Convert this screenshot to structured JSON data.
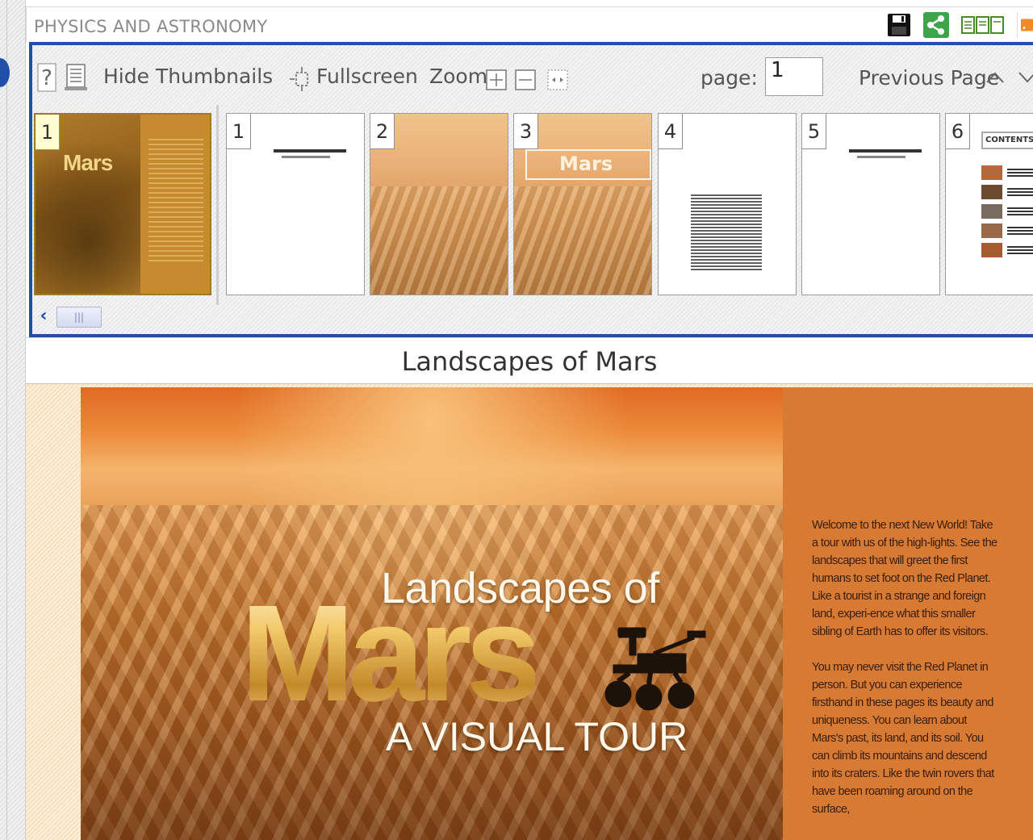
{
  "header": {
    "section_title": "PHYSICS AND ASTRONOMY",
    "icons": [
      "save-icon",
      "share-icon",
      "view-mode-icon",
      "rss-icon"
    ]
  },
  "toolbar": {
    "hide_thumbnails": "Hide Thumbnails",
    "fullscreen": "Fullscreen",
    "zoom_label": "Zoom:",
    "page_label": "page:",
    "page_value": "1",
    "previous_page": "Previous Page"
  },
  "thumbnails": [
    {
      "number": "1",
      "kind": "cover",
      "title": "Mars",
      "active": true
    },
    {
      "number": "1",
      "kind": "title-page",
      "title": "Landscapes of Mars"
    },
    {
      "number": "2",
      "kind": "photo"
    },
    {
      "number": "3",
      "kind": "photo-title",
      "title": "Mars"
    },
    {
      "number": "4",
      "kind": "text"
    },
    {
      "number": "5",
      "kind": "title-page",
      "title": "Landscapes of Mars"
    },
    {
      "number": "6",
      "kind": "contents",
      "title": "CONTENTS"
    }
  ],
  "document": {
    "title": "Landscapes of Mars",
    "cover": {
      "line1": "Landscapes of",
      "line2": "Mars",
      "line3": "A VISUAL TOUR"
    },
    "blurb": [
      "Welcome to the next New World! Take a tour with us of the high-lights. See the landscapes that will greet the first humans to set foot on the Red Planet. Like a tourist in a strange and foreign land, experi-ence what this smaller sibling of Earth has to offer its visitors.",
      "You may never visit the Red Planet in person. But you can experience firsthand in these pages its beauty and uniqueness. You can learn about Mars's past, its land, and its soil. You can climb its mountains and descend into its craters. Like the twin rovers that have been roaming around on the surface,"
    ]
  },
  "colors": {
    "accent_border": "#1f4fa6",
    "share_green": "#3da44a",
    "rss_orange": "#f08a24"
  }
}
